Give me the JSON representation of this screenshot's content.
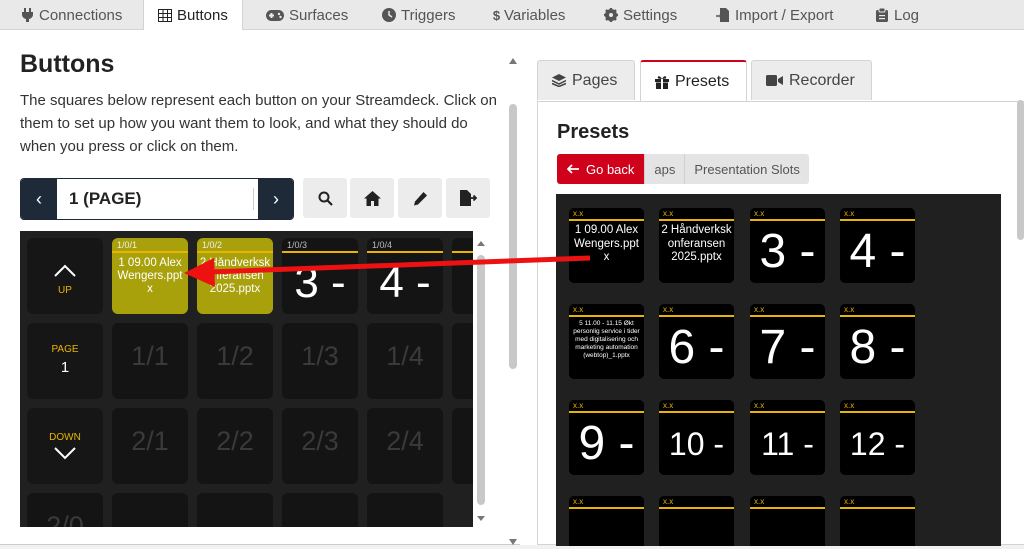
{
  "nav": {
    "tabs": [
      {
        "label": "Connections",
        "icon": "plug-icon"
      },
      {
        "label": "Buttons",
        "icon": "grid-icon"
      },
      {
        "label": "Surfaces",
        "icon": "gamepad-icon"
      },
      {
        "label": "Triggers",
        "icon": "clock-icon"
      },
      {
        "label": "Variables",
        "icon": "dollar-icon"
      },
      {
        "label": "Settings",
        "icon": "gear-icon"
      },
      {
        "label": "Import / Export",
        "icon": "file-import-icon"
      },
      {
        "label": "Log",
        "icon": "clipboard-icon"
      }
    ],
    "active": "Buttons"
  },
  "buttons": {
    "title": "Buttons",
    "description": "The squares below represent each button on your Streamdeck. Click on them to set up how you want them to look, and what they should do when you press or click on them.",
    "page_select": "1 (PAGE)"
  },
  "grid": {
    "controls": {
      "up": "UP",
      "page_label": "PAGE",
      "page_num": "1",
      "down": "DOWN"
    },
    "row0": [
      {
        "loc": "1/0/1",
        "text": "1 09.00 Alex Wengers.ppt x"
      },
      {
        "loc": "1/0/2",
        "text": "2 Håndverksk onferansen 2025.pptx"
      },
      {
        "loc": "1/0/3",
        "text": "3 -"
      },
      {
        "loc": "1/0/4",
        "text": "4 -"
      }
    ],
    "row1": [
      "1/1",
      "1/2",
      "1/3",
      "1/4"
    ],
    "row2": [
      "2/1",
      "2/2",
      "2/3",
      "2/4"
    ],
    "row3_partial": "2/0"
  },
  "right": {
    "tabs": [
      {
        "label": "Pages",
        "icon": "layers-icon"
      },
      {
        "label": "Presets",
        "icon": "gift-icon"
      },
      {
        "label": "Recorder",
        "icon": "video-icon"
      }
    ],
    "active_tab": "Presets",
    "presets_title": "Presets",
    "go_back": "Go back",
    "crumb1": "aps",
    "crumb2": "Presentation Slots",
    "cell_label": "x.x",
    "presets": [
      "1 09.00 Alex Wengers.ppt x",
      "2 Håndverksk onferansen 2025.pptx",
      "3 -",
      "4 -",
      "5 11.00 - 11.15 Økt personlig service i tider med digitalisering och marketing automation (webtop)_1.pptx",
      "6 -",
      "7 -",
      "8 -",
      "9 -",
      "10 -",
      "11 -",
      "12 -"
    ]
  },
  "colors": {
    "accent_red": "#d0021b",
    "yellow": "#e8b400",
    "olive": "#a8a10c",
    "navy": "#1f2a38"
  }
}
